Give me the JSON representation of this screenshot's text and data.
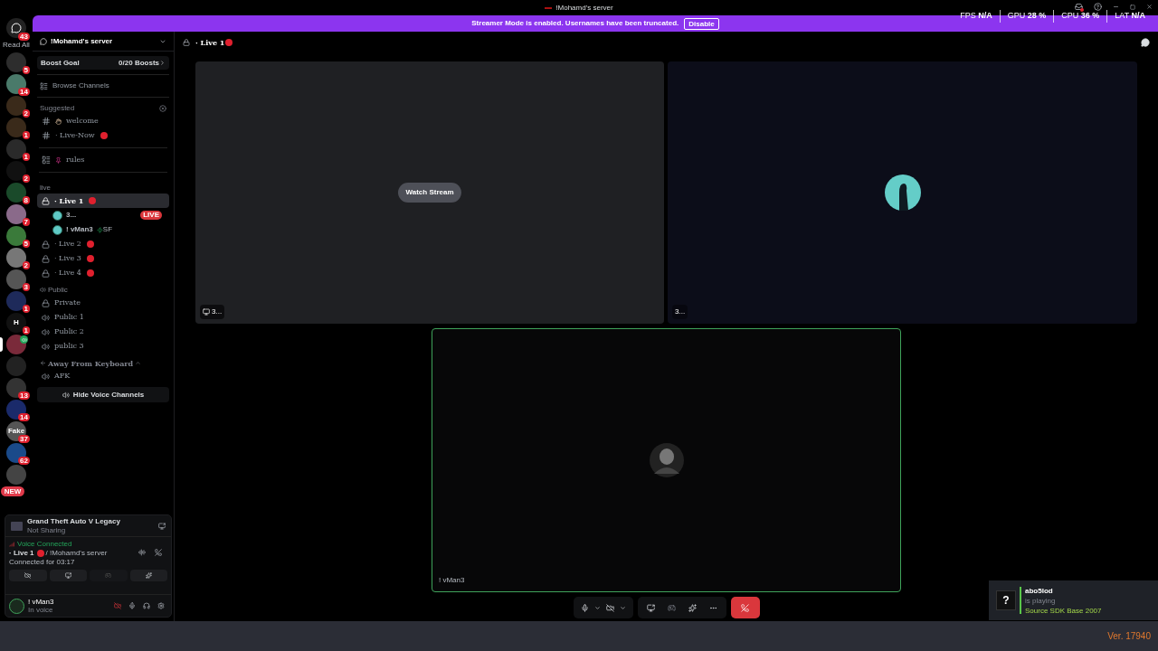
{
  "window": {
    "title": "!Mohamd's server"
  },
  "overlay_stats": [
    {
      "label": "FPS",
      "value": "N/A"
    },
    {
      "label": "GPU",
      "value": "28 %"
    },
    {
      "label": "CPU",
      "value": "36 %"
    },
    {
      "label": "LAT",
      "value": "N/A"
    }
  ],
  "banner": {
    "text": "Streamer Mode is enabled. Usernames have been truncated.",
    "button": "Disable"
  },
  "server_rail": {
    "read_all": "Read All",
    "servers": [
      {
        "kind": "home",
        "badge": "43"
      },
      {
        "kind": "server",
        "badge": "5"
      },
      {
        "kind": "server",
        "badge": "14"
      },
      {
        "kind": "server",
        "badge": "2"
      },
      {
        "kind": "server",
        "badge": "1"
      },
      {
        "kind": "server",
        "badge": "1"
      },
      {
        "kind": "server",
        "badge": "2"
      },
      {
        "kind": "server",
        "badge": "8"
      },
      {
        "kind": "server",
        "badge": "7"
      },
      {
        "kind": "server",
        "badge": "5"
      },
      {
        "kind": "server",
        "badge": "2"
      },
      {
        "kind": "server",
        "badge": "3"
      },
      {
        "kind": "server",
        "badge": "1"
      },
      {
        "kind": "server",
        "label": "H",
        "badge": "1"
      },
      {
        "kind": "voice",
        "selected": true
      },
      {
        "kind": "server"
      },
      {
        "kind": "server",
        "badge": "13"
      },
      {
        "kind": "server",
        "badge": "14"
      },
      {
        "kind": "server",
        "label": "Fake",
        "badge": "37"
      },
      {
        "kind": "server",
        "badge": "62"
      },
      {
        "kind": "server"
      },
      {
        "kind": "new",
        "label": "NEW"
      }
    ]
  },
  "sidebar": {
    "server_name": "!Mohamd's server",
    "boost": {
      "label": "Boost Goal",
      "value": "0/20 Boosts"
    },
    "browse": "Browse Channels",
    "items": [
      {
        "kind": "category",
        "label": "Suggested"
      },
      {
        "kind": "welcome",
        "label": "welcome",
        "selected": false
      },
      {
        "kind": "text",
        "label": "· Live-Now",
        "live_dot": true,
        "selected": false
      },
      {
        "kind": "divider"
      },
      {
        "kind": "rules",
        "label": "rules",
        "selected": false
      },
      {
        "kind": "divider"
      },
      {
        "kind": "category",
        "label": "live"
      },
      {
        "kind": "locked",
        "label": "· Live 1",
        "live_dot": true,
        "selected": true,
        "members": [
          {
            "name": "3...",
            "badge": "LIVE"
          },
          {
            "name": "! vMan3",
            "tag": "SF"
          }
        ]
      },
      {
        "kind": "locked",
        "label": "· Live 2",
        "live_dot": true,
        "selected": false
      },
      {
        "kind": "locked",
        "label": "· Live 3",
        "live_dot": true,
        "selected": false
      },
      {
        "kind": "locked",
        "label": "· Live 4",
        "live_dot": true,
        "selected": false
      },
      {
        "kind": "voice_category",
        "label": "Public"
      },
      {
        "kind": "locked",
        "label": "Private",
        "live_dot": false,
        "selected": false
      },
      {
        "kind": "voice",
        "label": "Public 1",
        "selected": false
      },
      {
        "kind": "voice",
        "label": "Public 2",
        "selected": false
      },
      {
        "kind": "voice",
        "label": "public 3",
        "selected": false
      },
      {
        "kind": "afk_category",
        "label": "Away From Keyboard"
      },
      {
        "kind": "voice",
        "label": "AFK",
        "selected": false
      }
    ],
    "hide_button": "Hide Voice Channels"
  },
  "voice_panel": {
    "activity": {
      "game": "Grand Theft Auto V Legacy",
      "status": "Not Sharing"
    },
    "connection": {
      "status": "Voice Connected",
      "channel": "· Live 1",
      "server": "/ !Mohamd's server",
      "duration": "Connected for 03:17"
    },
    "user": {
      "name": "! vMan3",
      "status": "In voice",
      "camera_off": true
    }
  },
  "main": {
    "title": "· Live 1",
    "tiles": [
      {
        "kind": "stream",
        "button": "Watch Stream",
        "tag": "3..."
      },
      {
        "kind": "avatar",
        "tag": "3..."
      },
      {
        "kind": "camera",
        "name": "! vMan3",
        "speaking": true
      }
    ]
  },
  "notification": {
    "icon": "?",
    "name": "abo5lod",
    "action": "is playing",
    "game": "Source SDK Base 2007"
  },
  "version": "Ver. 17940"
}
